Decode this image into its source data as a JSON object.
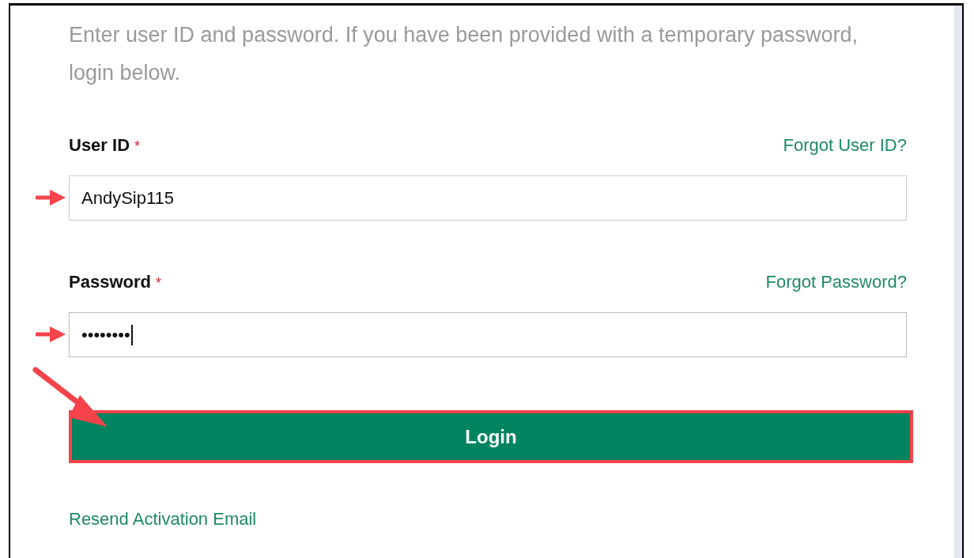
{
  "intro": "Enter user ID and password. If you have been provided with a temporary password, login below.",
  "fields": [
    {
      "label": "User ID",
      "required_mark": "*",
      "link": "Forgot User ID?",
      "value": "AndySip115",
      "focused": false,
      "annotated": true
    },
    {
      "label": "Password",
      "required_mark": "*",
      "link": "Forgot Password?",
      "value": "••••••••",
      "focused": true,
      "annotated": true
    }
  ],
  "login_button": {
    "label": "Login",
    "highlighted": true,
    "annotated": true
  },
  "resend_link": "Resend Activation Email"
}
